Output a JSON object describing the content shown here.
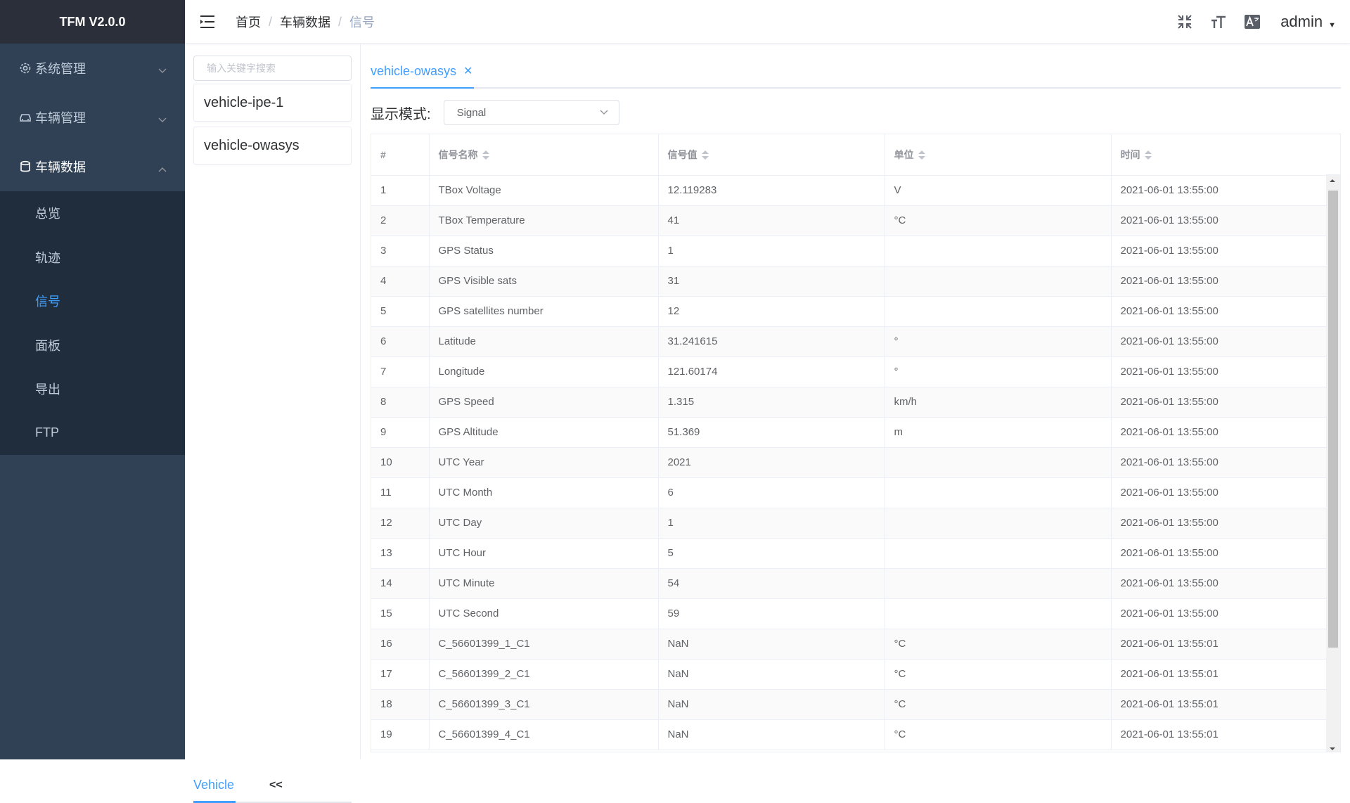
{
  "app": {
    "title": "TFM V2.0.0"
  },
  "sidebar": {
    "menus": [
      {
        "label": "系统管理",
        "icon": "gear-icon"
      },
      {
        "label": "车辆管理",
        "icon": "car-icon"
      },
      {
        "label": "车辆数据",
        "icon": "database-icon"
      }
    ],
    "submenu": [
      {
        "label": "总览"
      },
      {
        "label": "轨迹"
      },
      {
        "label": "信号",
        "active": true
      },
      {
        "label": "面板"
      },
      {
        "label": "导出"
      },
      {
        "label": "FTP"
      }
    ]
  },
  "navbar": {
    "breadcrumb": [
      "首页",
      "车辆数据",
      "信号"
    ],
    "icons": [
      "exit-fullscreen-icon",
      "font-size-icon",
      "translate-icon"
    ],
    "user": "admin"
  },
  "vehicle_panel": {
    "search_placeholder": "输入关键字搜索",
    "vehicles": [
      "vehicle-ipe-1",
      "vehicle-owasys"
    ],
    "tab_vehicle": "Vehicle",
    "collapse": "<<"
  },
  "main": {
    "tab": "vehicle-owasys",
    "mode_label": "显示模式:",
    "mode_value": "Signal"
  },
  "table": {
    "columns": [
      "#",
      "信号名称",
      "信号值",
      "单位",
      "时间"
    ],
    "rows": [
      [
        "1",
        "TBox Voltage",
        "12.119283",
        "V",
        "2021-06-01 13:55:00"
      ],
      [
        "2",
        "TBox Temperature",
        "41",
        "°C",
        "2021-06-01 13:55:00"
      ],
      [
        "3",
        "GPS Status",
        "1",
        "",
        "2021-06-01 13:55:00"
      ],
      [
        "4",
        "GPS Visible sats",
        "31",
        "",
        "2021-06-01 13:55:00"
      ],
      [
        "5",
        "GPS satellites number",
        "12",
        "",
        "2021-06-01 13:55:00"
      ],
      [
        "6",
        "Latitude",
        "31.241615",
        "°",
        "2021-06-01 13:55:00"
      ],
      [
        "7",
        "Longitude",
        "121.60174",
        "°",
        "2021-06-01 13:55:00"
      ],
      [
        "8",
        "GPS Speed",
        "1.315",
        "km/h",
        "2021-06-01 13:55:00"
      ],
      [
        "9",
        "GPS Altitude",
        "51.369",
        "m",
        "2021-06-01 13:55:00"
      ],
      [
        "10",
        "UTC Year",
        "2021",
        "",
        "2021-06-01 13:55:00"
      ],
      [
        "11",
        "UTC Month",
        "6",
        "",
        "2021-06-01 13:55:00"
      ],
      [
        "12",
        "UTC Day",
        "1",
        "",
        "2021-06-01 13:55:00"
      ],
      [
        "13",
        "UTC Hour",
        "5",
        "",
        "2021-06-01 13:55:00"
      ],
      [
        "14",
        "UTC Minute",
        "54",
        "",
        "2021-06-01 13:55:00"
      ],
      [
        "15",
        "UTC Second",
        "59",
        "",
        "2021-06-01 13:55:00"
      ],
      [
        "16",
        "C_56601399_1_C1",
        "NaN",
        "°C",
        "2021-06-01 13:55:01"
      ],
      [
        "17",
        "C_56601399_2_C1",
        "NaN",
        "°C",
        "2021-06-01 13:55:01"
      ],
      [
        "18",
        "C_56601399_3_C1",
        "NaN",
        "°C",
        "2021-06-01 13:55:01"
      ],
      [
        "19",
        "C_56601399_4_C1",
        "NaN",
        "°C",
        "2021-06-01 13:55:01"
      ]
    ]
  },
  "colors": {
    "sidebar_bg": "#304156",
    "submenu_bg": "#1f2d3d",
    "accent": "#409eff"
  }
}
